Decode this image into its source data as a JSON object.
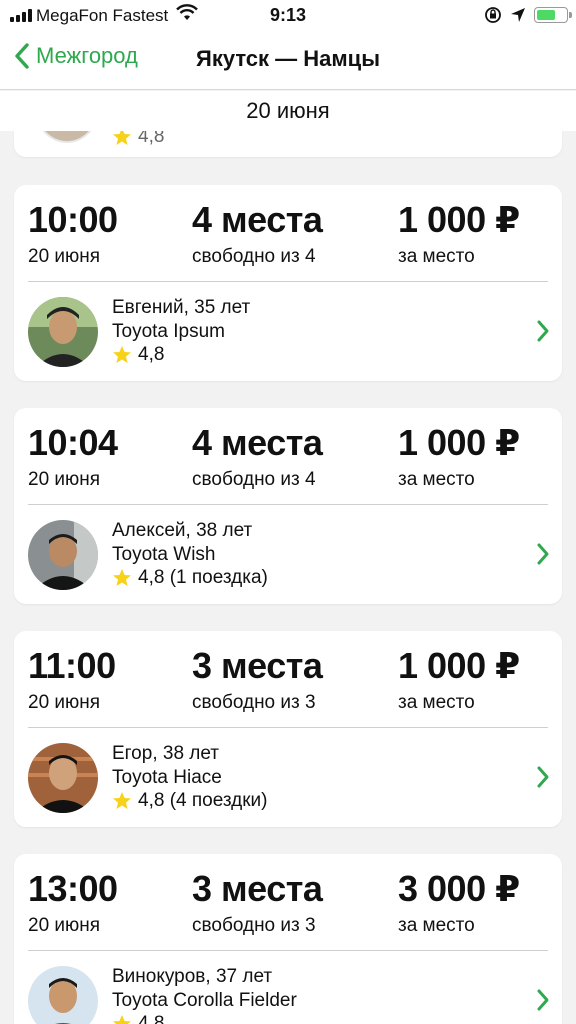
{
  "status_bar": {
    "carrier": "MegaFon Fastest",
    "time": "9:13",
    "battery_level": 0.65,
    "icons": [
      "signal-icon",
      "wifi-icon",
      "lock-rotation-icon",
      "location-arrow-icon",
      "battery-icon"
    ]
  },
  "nav": {
    "back_label": "Межгород",
    "title": "Якутск — Намцы"
  },
  "date_header": "20 июня",
  "partial_card": {
    "rating": "4,8"
  },
  "colors": {
    "accent": "#2fa84f",
    "star": "#f7d21a",
    "background": "#f2f2f2"
  },
  "rides": [
    {
      "time": "10:00",
      "date": "20 июня",
      "seats": "4 места",
      "seats_sub": "свободно из 4",
      "price": "1 000 ₽",
      "price_sub": "за место",
      "driver": "Евгений, 35 лет",
      "car": "Toyota Ipsum",
      "rating": "4,8"
    },
    {
      "time": "10:04",
      "date": "20 июня",
      "seats": "4 места",
      "seats_sub": "свободно из 4",
      "price": "1 000 ₽",
      "price_sub": "за место",
      "driver": "Алексей, 38 лет",
      "car": "Toyota Wish",
      "rating": "4,8 (1 поездка)"
    },
    {
      "time": "11:00",
      "date": "20 июня",
      "seats": "3 места",
      "seats_sub": "свободно из 3",
      "price": "1 000 ₽",
      "price_sub": "за место",
      "driver": "Егор, 38 лет",
      "car": "Toyota Hiace",
      "rating": "4,8 (4 поездки)"
    },
    {
      "time": "13:00",
      "date": "20 июня",
      "seats": "3 места",
      "seats_sub": "свободно из 3",
      "price": "3 000 ₽",
      "price_sub": "за место",
      "driver": "Винокуров, 37 лет",
      "car": "Toyota Corolla Fielder",
      "rating": "4,8"
    }
  ]
}
